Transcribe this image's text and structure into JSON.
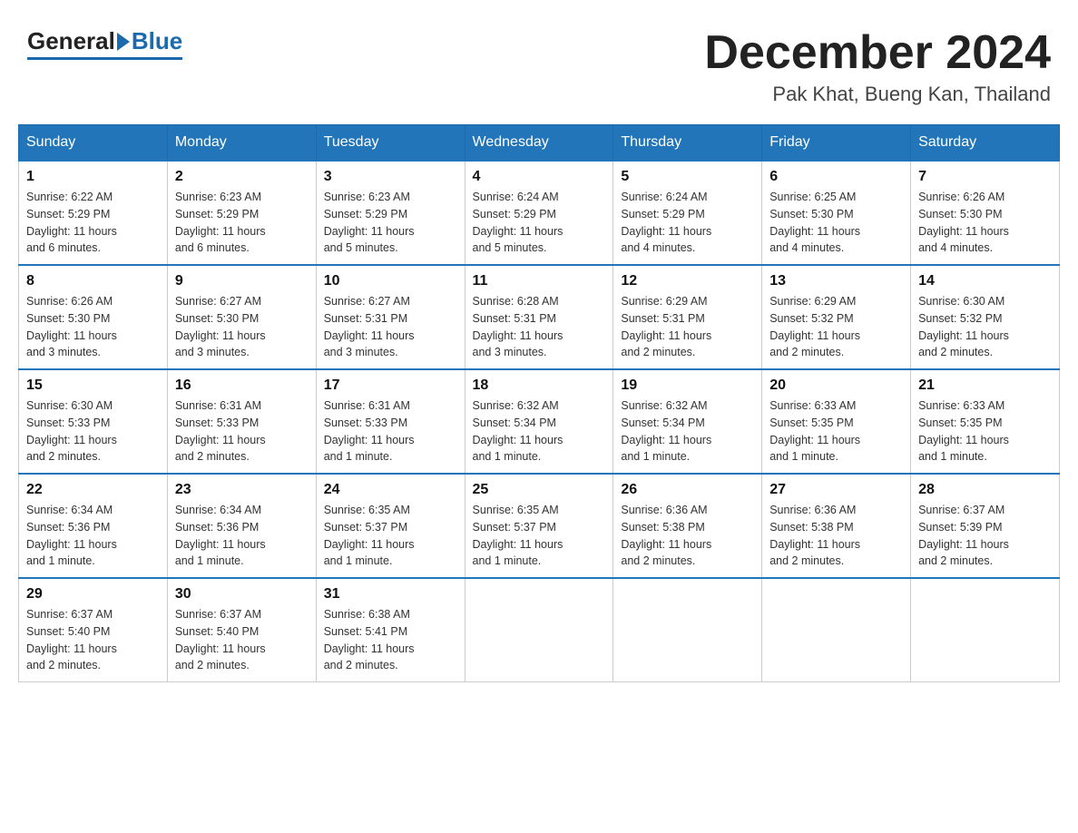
{
  "header": {
    "logo_general": "General",
    "logo_blue": "Blue",
    "month_title": "December 2024",
    "location": "Pak Khat, Bueng Kan, Thailand"
  },
  "days_of_week": [
    "Sunday",
    "Monday",
    "Tuesday",
    "Wednesday",
    "Thursday",
    "Friday",
    "Saturday"
  ],
  "weeks": [
    [
      {
        "day": "1",
        "sunrise": "6:22 AM",
        "sunset": "5:29 PM",
        "daylight": "11 hours and 6 minutes."
      },
      {
        "day": "2",
        "sunrise": "6:23 AM",
        "sunset": "5:29 PM",
        "daylight": "11 hours and 6 minutes."
      },
      {
        "day": "3",
        "sunrise": "6:23 AM",
        "sunset": "5:29 PM",
        "daylight": "11 hours and 5 minutes."
      },
      {
        "day": "4",
        "sunrise": "6:24 AM",
        "sunset": "5:29 PM",
        "daylight": "11 hours and 5 minutes."
      },
      {
        "day": "5",
        "sunrise": "6:24 AM",
        "sunset": "5:29 PM",
        "daylight": "11 hours and 4 minutes."
      },
      {
        "day": "6",
        "sunrise": "6:25 AM",
        "sunset": "5:30 PM",
        "daylight": "11 hours and 4 minutes."
      },
      {
        "day": "7",
        "sunrise": "6:26 AM",
        "sunset": "5:30 PM",
        "daylight": "11 hours and 4 minutes."
      }
    ],
    [
      {
        "day": "8",
        "sunrise": "6:26 AM",
        "sunset": "5:30 PM",
        "daylight": "11 hours and 3 minutes."
      },
      {
        "day": "9",
        "sunrise": "6:27 AM",
        "sunset": "5:30 PM",
        "daylight": "11 hours and 3 minutes."
      },
      {
        "day": "10",
        "sunrise": "6:27 AM",
        "sunset": "5:31 PM",
        "daylight": "11 hours and 3 minutes."
      },
      {
        "day": "11",
        "sunrise": "6:28 AM",
        "sunset": "5:31 PM",
        "daylight": "11 hours and 3 minutes."
      },
      {
        "day": "12",
        "sunrise": "6:29 AM",
        "sunset": "5:31 PM",
        "daylight": "11 hours and 2 minutes."
      },
      {
        "day": "13",
        "sunrise": "6:29 AM",
        "sunset": "5:32 PM",
        "daylight": "11 hours and 2 minutes."
      },
      {
        "day": "14",
        "sunrise": "6:30 AM",
        "sunset": "5:32 PM",
        "daylight": "11 hours and 2 minutes."
      }
    ],
    [
      {
        "day": "15",
        "sunrise": "6:30 AM",
        "sunset": "5:33 PM",
        "daylight": "11 hours and 2 minutes."
      },
      {
        "day": "16",
        "sunrise": "6:31 AM",
        "sunset": "5:33 PM",
        "daylight": "11 hours and 2 minutes."
      },
      {
        "day": "17",
        "sunrise": "6:31 AM",
        "sunset": "5:33 PM",
        "daylight": "11 hours and 1 minute."
      },
      {
        "day": "18",
        "sunrise": "6:32 AM",
        "sunset": "5:34 PM",
        "daylight": "11 hours and 1 minute."
      },
      {
        "day": "19",
        "sunrise": "6:32 AM",
        "sunset": "5:34 PM",
        "daylight": "11 hours and 1 minute."
      },
      {
        "day": "20",
        "sunrise": "6:33 AM",
        "sunset": "5:35 PM",
        "daylight": "11 hours and 1 minute."
      },
      {
        "day": "21",
        "sunrise": "6:33 AM",
        "sunset": "5:35 PM",
        "daylight": "11 hours and 1 minute."
      }
    ],
    [
      {
        "day": "22",
        "sunrise": "6:34 AM",
        "sunset": "5:36 PM",
        "daylight": "11 hours and 1 minute."
      },
      {
        "day": "23",
        "sunrise": "6:34 AM",
        "sunset": "5:36 PM",
        "daylight": "11 hours and 1 minute."
      },
      {
        "day": "24",
        "sunrise": "6:35 AM",
        "sunset": "5:37 PM",
        "daylight": "11 hours and 1 minute."
      },
      {
        "day": "25",
        "sunrise": "6:35 AM",
        "sunset": "5:37 PM",
        "daylight": "11 hours and 1 minute."
      },
      {
        "day": "26",
        "sunrise": "6:36 AM",
        "sunset": "5:38 PM",
        "daylight": "11 hours and 2 minutes."
      },
      {
        "day": "27",
        "sunrise": "6:36 AM",
        "sunset": "5:38 PM",
        "daylight": "11 hours and 2 minutes."
      },
      {
        "day": "28",
        "sunrise": "6:37 AM",
        "sunset": "5:39 PM",
        "daylight": "11 hours and 2 minutes."
      }
    ],
    [
      {
        "day": "29",
        "sunrise": "6:37 AM",
        "sunset": "5:40 PM",
        "daylight": "11 hours and 2 minutes."
      },
      {
        "day": "30",
        "sunrise": "6:37 AM",
        "sunset": "5:40 PM",
        "daylight": "11 hours and 2 minutes."
      },
      {
        "day": "31",
        "sunrise": "6:38 AM",
        "sunset": "5:41 PM",
        "daylight": "11 hours and 2 minutes."
      },
      null,
      null,
      null,
      null
    ]
  ],
  "labels": {
    "sunrise": "Sunrise:",
    "sunset": "Sunset:",
    "daylight": "Daylight:"
  }
}
